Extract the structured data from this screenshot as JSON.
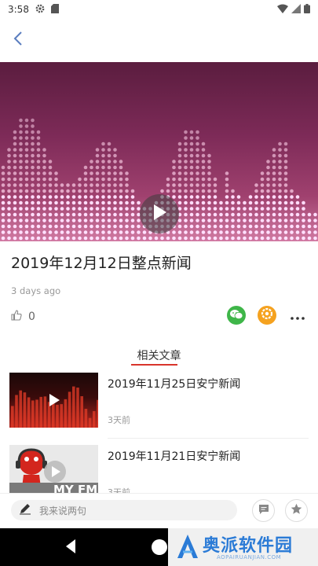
{
  "status_bar": {
    "time": "3:58",
    "icons": [
      "gear-icon",
      "sd-card-icon",
      "wifi-icon",
      "signal-icon",
      "battery-icon"
    ]
  },
  "nav": {
    "back_icon": "chevron-left-icon"
  },
  "video": {
    "play_icon": "play-icon"
  },
  "article": {
    "title": "2019年12月12日整点新闻",
    "time": "3 days ago",
    "like_count": "0"
  },
  "share": {
    "wechat_icon": "wechat-icon",
    "moments_icon": "moments-icon",
    "more_icon": "more-icon"
  },
  "related": {
    "heading": "相关文章",
    "items": [
      {
        "title": "2019年11月25日安宁新闻",
        "time": "3天前"
      },
      {
        "title": "2019年11月21日安宁新闻",
        "time": "3天前",
        "thumb_text": "MY FM"
      }
    ]
  },
  "comment_bar": {
    "placeholder": "我来说两句",
    "edit_icon": "pencil-icon",
    "comments_icon": "comment-icon",
    "favorite_icon": "star-icon"
  },
  "watermark": {
    "text": "奥派软件园",
    "url": "AOPAIRUANJIAN.COM"
  },
  "colors": {
    "accent": "#d9342b",
    "wechat": "#3fb649",
    "moments": "#f5a21f",
    "video_top": "#5b1d3f",
    "video_bottom": "#d17aa3"
  }
}
